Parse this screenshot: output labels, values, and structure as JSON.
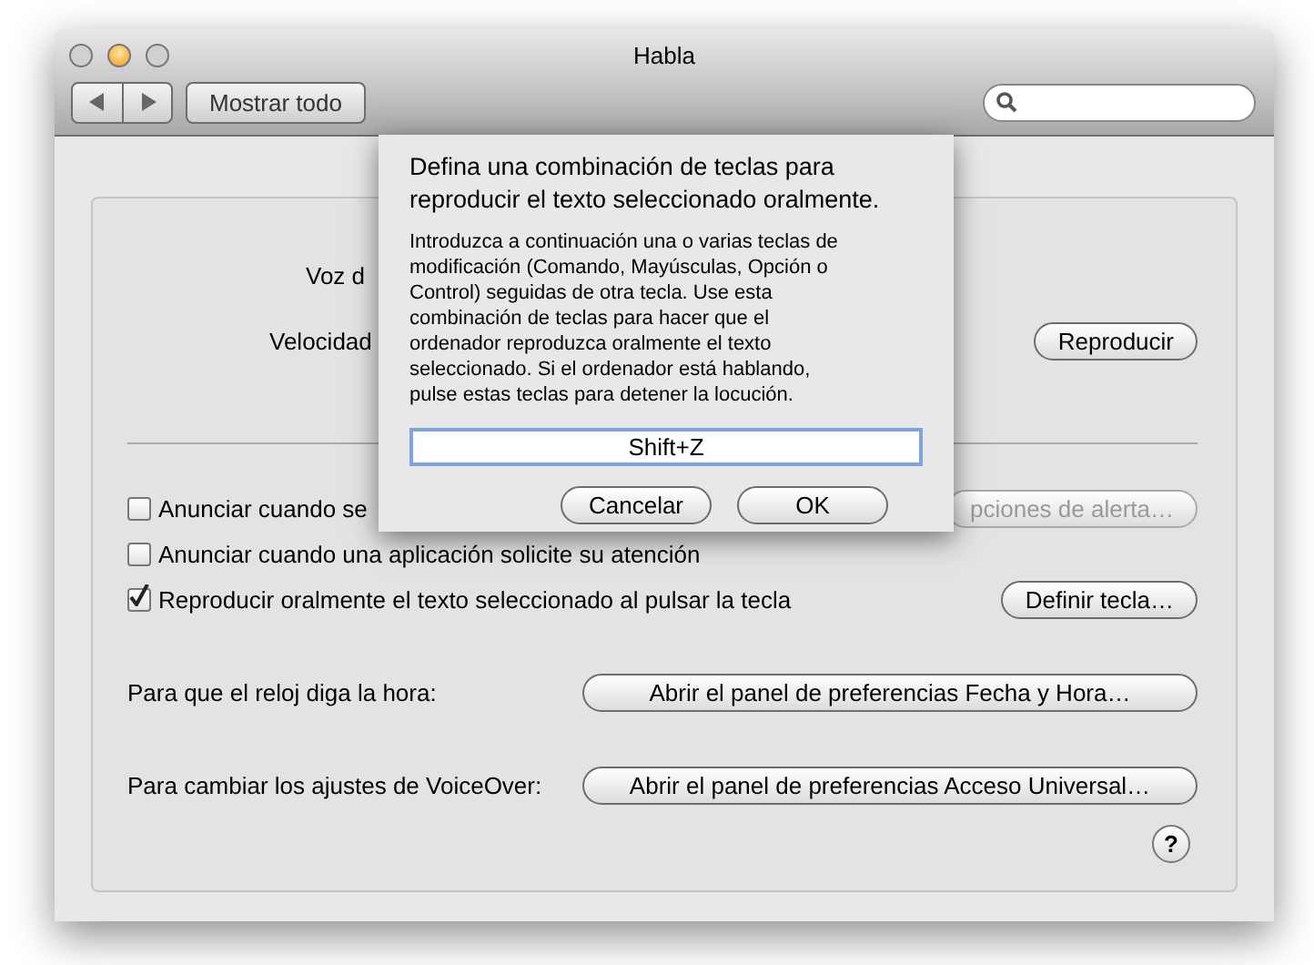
{
  "window": {
    "title": "Habla"
  },
  "toolbar": {
    "show_all": "Mostrar todo"
  },
  "voice_label": "Voz d",
  "rate_label": "Velocidad",
  "play_button": "Reproducir",
  "checkboxes": [
    {
      "label": "Anunciar cuando se",
      "checked": false,
      "button": {
        "label": "pciones de alerta…",
        "disabled": true
      }
    },
    {
      "label": "Anunciar cuando una aplicación solicite su atención",
      "checked": false
    },
    {
      "label": "Reproducir oralmente el texto seleccionado al pulsar la tecla",
      "checked": true,
      "button": {
        "label": "Definir tecla…",
        "disabled": false
      }
    }
  ],
  "links": [
    {
      "label": "Para que el reloj diga la hora:",
      "button": "Abrir el panel de preferencias Fecha y Hora…"
    },
    {
      "label": "Para cambiar los ajustes de VoiceOver:",
      "button": "Abrir el panel de preferencias Acceso Universal…"
    }
  ],
  "help": "?",
  "sheet": {
    "title": "Defina una combinación de teclas para reproducir el texto seleccionado oralmente.",
    "message": "Introduzca a continuación una o varias teclas de modificación (Comando, Mayúsculas, Opción o Control) seguidas de otra tecla. Use esta combinación de teclas para hacer que el ordenador reproduzca oralmente el texto seleccionado. Si el ordenador está hablando, pulse estas teclas para detener la locución.",
    "value": "Shift+Z",
    "buttons": [
      "Cancelar",
      "OK"
    ]
  }
}
